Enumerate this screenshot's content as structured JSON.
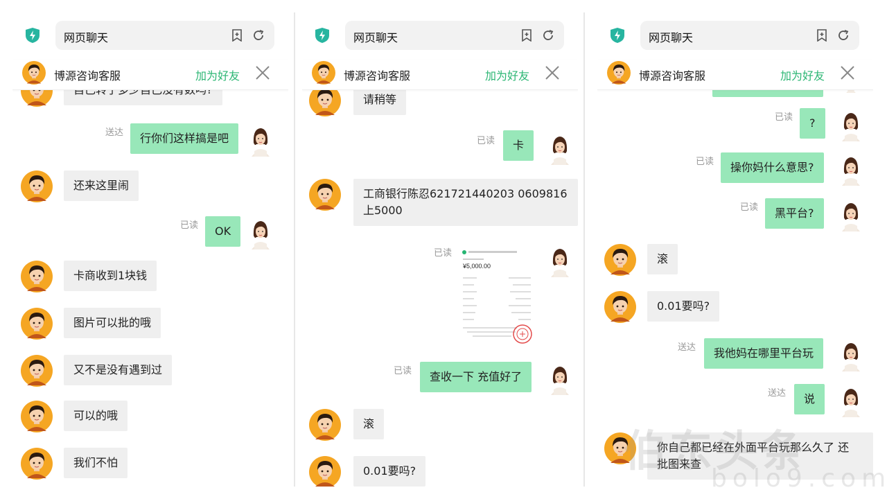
{
  "header": {
    "url_title": "网页聊天",
    "agent_name": "博源咨询客服",
    "add_friend": "加为好友"
  },
  "colors": {
    "accent_green": "#2bb673",
    "outgoing_bubble": "#98e7b9",
    "incoming_bubble": "#efefef",
    "status_text": "#999999"
  },
  "panel1": {
    "m1": "自己转了多少自己没有数吗?",
    "s2": "送达",
    "m2": "行你们这样搞是吧",
    "m3": "还来这里闹",
    "s4": "已读",
    "m4": "OK",
    "m5": "卡商收到1块钱",
    "m6": "图片可以批的哦",
    "m7": "又不是没有遇到过",
    "m8": "可以的哦",
    "m9": "我们不怕"
  },
  "panel2": {
    "m1": "请稍等",
    "s2": "已读",
    "m2": "卡",
    "m3a": "工商银行陈忍621721440203 0609816",
    "m3b": "上5000",
    "s4": "已读",
    "receipt_amount": "¥5,000.00",
    "s5": "已读",
    "m5": "查收一下 充值好了",
    "m6": "滚",
    "m7": "0.01要吗?"
  },
  "panel3": {
    "s1": "已读",
    "m1": "?",
    "s2": "已读",
    "m2": "操你妈什么意思?",
    "s3": "已读",
    "m3": "黑平台?",
    "m4": "滚",
    "m5": "0.01要吗?",
    "s6": "送达",
    "m6": "我他妈在哪里平台玩",
    "s7": "送达",
    "m7": "说",
    "m8a": "你自己都已经在外面平台玩那么久了 还",
    "m8b": "批图来查"
  },
  "watermark": {
    "text": "伯东头条",
    "sub": "bolo9.com"
  }
}
